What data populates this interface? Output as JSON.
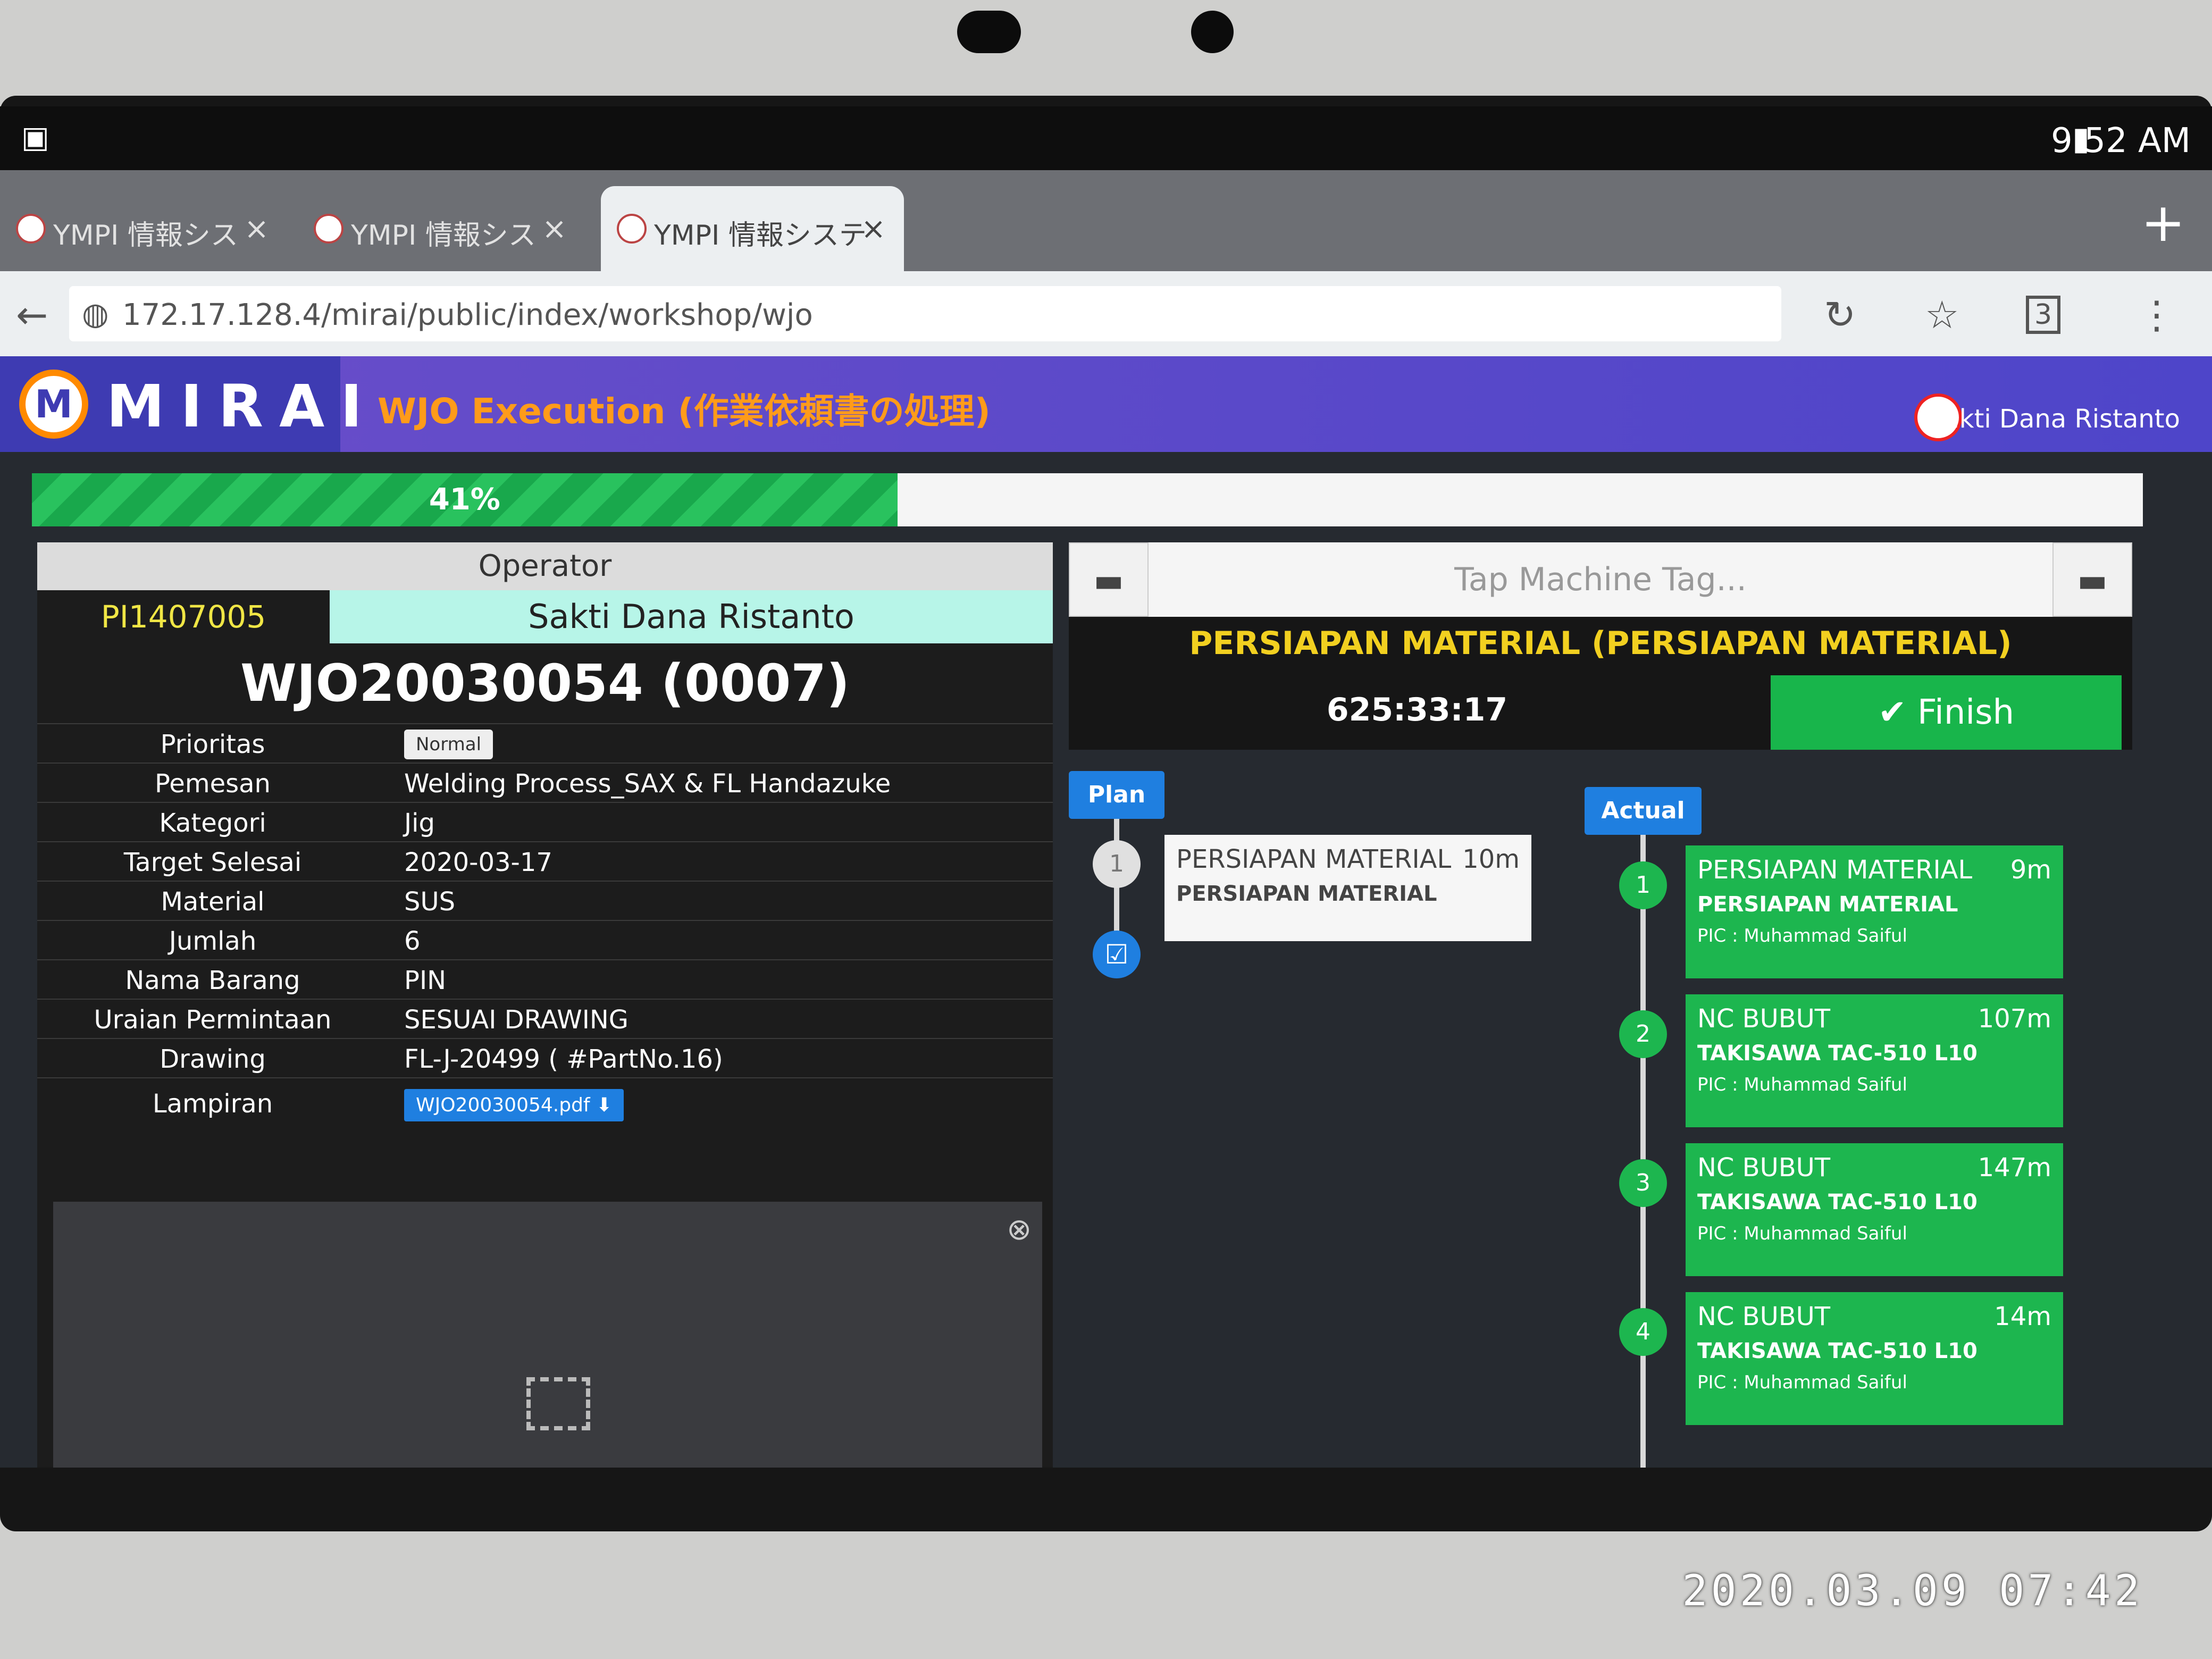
{
  "status_bar": {
    "time": "9:52 AM"
  },
  "browser": {
    "tabs": [
      {
        "title": "YMPI 情報シス"
      },
      {
        "title": "YMPI 情報シス"
      },
      {
        "title": "YMPI 情報システ"
      }
    ],
    "url": "172.17.128.4/mirai/public/index/workshop/wjo",
    "tab_count": "3"
  },
  "app": {
    "logo_text": "MIRAI",
    "page_title": "WJO Execution (作業依頼書の処理)",
    "user_name": "Sakti Dana Ristanto",
    "progress_percent": 41,
    "progress_label": "41%"
  },
  "operator": {
    "header": "Operator",
    "id": "PI1407005",
    "name": "Sakti Dana Ristanto"
  },
  "wjo": {
    "title": "WJO20030054 (0007)",
    "fields": [
      {
        "label": "Prioritas",
        "value": "Normal"
      },
      {
        "label": "Pemesan",
        "value": "Welding Process_SAX & FL Handazuke"
      },
      {
        "label": "Kategori",
        "value": "Jig"
      },
      {
        "label": "Target Selesai",
        "value": "2020-03-17"
      },
      {
        "label": "Material",
        "value": "SUS"
      },
      {
        "label": "Jumlah",
        "value": "6"
      },
      {
        "label": "Nama Barang",
        "value": "PIN"
      },
      {
        "label": "Uraian Permintaan",
        "value": "SESUAI DRAWING"
      },
      {
        "label": "Drawing",
        "value": "FL-J-20499 ( #PartNo.16)"
      },
      {
        "label": "Lampiran",
        "value": "WJO20030054.pdf"
      }
    ]
  },
  "execution": {
    "tag_placeholder": "Tap Machine Tag...",
    "process_title": "PERSIAPAN MATERIAL (PERSIAPAN MATERIAL)",
    "timer": "625:33:17",
    "finish_label": "Finish",
    "plan_label": "Plan",
    "actual_label": "Actual",
    "plan_steps": [
      {
        "num": "1",
        "name": "PERSIAPAN MATERIAL",
        "duration": "10m",
        "machine": "PERSIAPAN MATERIAL"
      }
    ],
    "actual_steps": [
      {
        "num": "1",
        "name": "PERSIAPAN MATERIAL",
        "duration": "9m",
        "machine": "PERSIAPAN MATERIAL",
        "pic": "PIC : Muhammad Saiful"
      },
      {
        "num": "2",
        "name": "NC BUBUT",
        "duration": "107m",
        "machine": "TAKISAWA TAC-510 L10",
        "pic": "PIC : Muhammad Saiful"
      },
      {
        "num": "3",
        "name": "NC BUBUT",
        "duration": "147m",
        "machine": "TAKISAWA TAC-510 L10",
        "pic": "PIC : Muhammad Saiful"
      },
      {
        "num": "4",
        "name": "NC BUBUT",
        "duration": "14m",
        "machine": "TAKISAWA TAC-510 L10",
        "pic": "PIC : Muhammad Saiful"
      }
    ]
  },
  "photo_timestamp": "2020.03.09 07:42",
  "colors": {
    "accent": "#4e45c9",
    "success": "#1db64f",
    "warning": "#f2d020",
    "primary": "#1f7fe0"
  }
}
